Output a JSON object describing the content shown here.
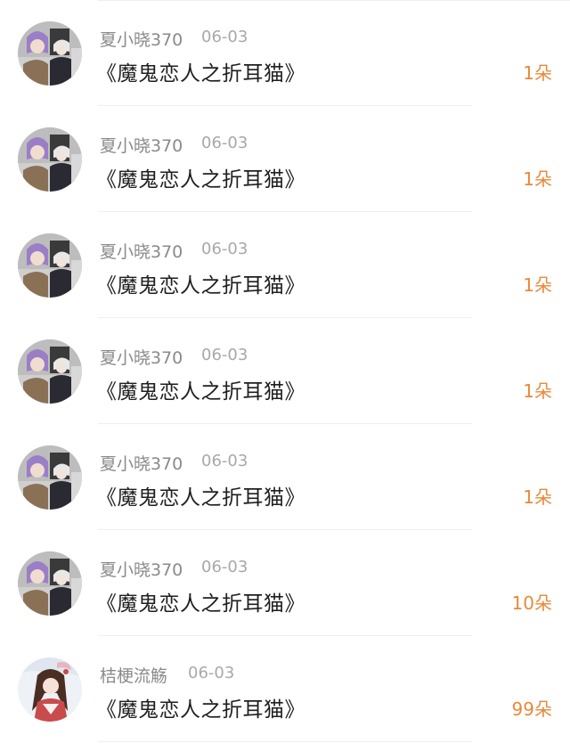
{
  "gift_list": {
    "items": [
      {
        "user": "夏小晓370",
        "date": "06-03",
        "title": "《魔鬼恋人之折耳猫》",
        "amount": "1朵",
        "avatar_icon": "anime-characters-avatar"
      },
      {
        "user": "夏小晓370",
        "date": "06-03",
        "title": "《魔鬼恋人之折耳猫》",
        "amount": "1朵",
        "avatar_icon": "anime-characters-avatar"
      },
      {
        "user": "夏小晓370",
        "date": "06-03",
        "title": "《魔鬼恋人之折耳猫》",
        "amount": "1朵",
        "avatar_icon": "anime-characters-avatar"
      },
      {
        "user": "夏小晓370",
        "date": "06-03",
        "title": "《魔鬼恋人之折耳猫》",
        "amount": "1朵",
        "avatar_icon": "anime-characters-avatar"
      },
      {
        "user": "夏小晓370",
        "date": "06-03",
        "title": "《魔鬼恋人之折耳猫》",
        "amount": "1朵",
        "avatar_icon": "anime-characters-avatar"
      },
      {
        "user": "夏小晓370",
        "date": "06-03",
        "title": "《魔鬼恋人之折耳猫》",
        "amount": "10朵",
        "avatar_icon": "anime-characters-avatar"
      },
      {
        "user": "桔梗流觞",
        "date": "06-03",
        "title": "《魔鬼恋人之折耳猫》",
        "amount": "99朵",
        "avatar_icon": "anime-girl-avatar"
      }
    ]
  },
  "colors": {
    "amount": "#e8893a",
    "name": "#8a8a8a",
    "date": "#a8a8a8",
    "title": "#1f1f1f"
  }
}
